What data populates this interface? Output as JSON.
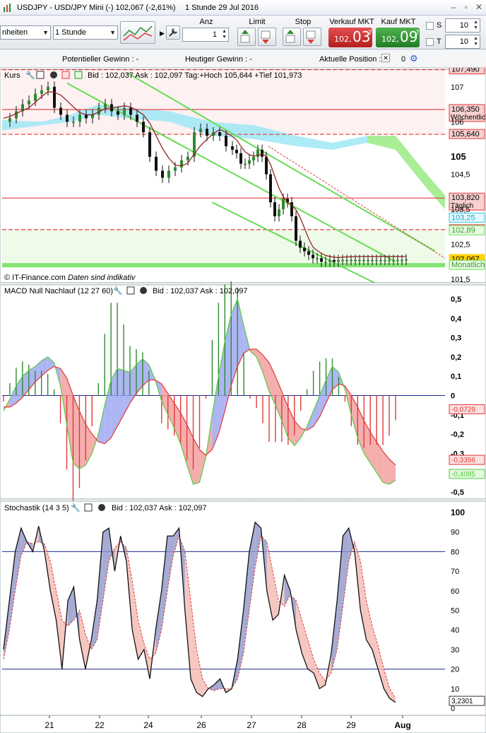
{
  "window": {
    "title": "USDJPY - USD/JPY Mini (-)",
    "quote": "102,067 (-2,61%)",
    "timeframe_date": "1 Stunde  29 Jul 2016"
  },
  "toolbar": {
    "units_select": "nheiten",
    "interval_select": "1 Stunde",
    "qty_label": "Anz",
    "qty_value": "1",
    "limit_label": "Limit",
    "stop_label": "Stop",
    "sell_label": "Verkauf MKT",
    "sell_small": "102,",
    "sell_big": "03",
    "sell_sup": "7",
    "buy_label": "Kauf MKT",
    "buy_small": "102,",
    "buy_big": "09",
    "buy_sup": "7",
    "s_label": "S",
    "s_value": "10",
    "t_label": "T",
    "t_value": "10"
  },
  "status": {
    "potential_profit": "Potentieller Gewinn : -",
    "today_profit": "Heutiger Gewinn : -",
    "position": "Aktuelle Position : 0",
    "position_extra": "0"
  },
  "colors": {
    "bull": "#2e8b2e",
    "bear": "#e03a3a",
    "green_line": "#66dd55",
    "cloud_cyan": "#9fe8f5",
    "cloud_green": "#a8ee8c",
    "macd_blue": "#9aa2f0",
    "macd_red": "#f29a9a",
    "stoch_blue": "#1f2a8f"
  },
  "chart_data": [
    {
      "type": "line",
      "title": "Kurs",
      "header": "Bid : 102,037 Ask : 102,097 Tag:+Hoch 105,644 +Tief 101,973",
      "source": "© IT-Finance.com",
      "disclaimer": "Daten sind indikativ",
      "y_ticks": [
        "107",
        "106",
        "105",
        "104,5",
        "103,5",
        "102,5",
        "101,5"
      ],
      "ylim": [
        101.4,
        107.5
      ],
      "x_dates": [
        "21",
        "22",
        "24",
        "26",
        "27",
        "28",
        "29",
        "Aug"
      ],
      "close_series": {
        "name": "USDJPY",
        "x": [
          0,
          3,
          6,
          9,
          12,
          15,
          18,
          21,
          24,
          27,
          30,
          33,
          36,
          39,
          42,
          45,
          48,
          51,
          54,
          57,
          60,
          63,
          66,
          69,
          72,
          75,
          78,
          81,
          84,
          87,
          90,
          93,
          96,
          99,
          102,
          105,
          108,
          110,
          112,
          114,
          116,
          118,
          120,
          122,
          124,
          126,
          128,
          130,
          132,
          134,
          136,
          138,
          140,
          142,
          144,
          146,
          148,
          150,
          152,
          154,
          156,
          158,
          160,
          162,
          164,
          166,
          168,
          170,
          172,
          174,
          176,
          178,
          180,
          182,
          184,
          186,
          188,
          190
        ],
        "values": [
          106.0,
          106.1,
          106.3,
          106.5,
          106.6,
          106.8,
          106.9,
          107.0,
          106.4,
          106.2,
          106.0,
          106.0,
          106.2,
          106.1,
          106.2,
          106.4,
          106.5,
          106.3,
          106.2,
          106.4,
          106.2,
          106.0,
          105.7,
          105.0,
          104.6,
          104.4,
          104.6,
          104.7,
          104.9,
          105.0,
          105.7,
          105.8,
          105.6,
          105.7,
          105.6,
          105.3,
          105.2,
          105.1,
          104.8,
          104.8,
          104.9,
          105.0,
          105.2,
          105.0,
          104.5,
          103.7,
          103.3,
          103.5,
          103.8,
          103.7,
          103.3,
          102.6,
          102.4,
          102.3,
          102.2,
          102.1,
          102.1,
          102.0,
          102.0,
          102.05,
          102.0,
          102.05,
          102.05,
          102.05,
          102.05,
          102.05,
          102.05,
          102.05,
          102.05,
          102.05,
          102.05,
          102.05,
          102.05,
          102.05,
          102.05,
          102.05,
          102.05,
          102.067
        ]
      },
      "levels": [
        {
          "label": "107,490",
          "value": 107.49,
          "color": "#e03a3a"
        },
        {
          "label": "106,350",
          "sublabel": "Wöchentlich",
          "value": 106.35,
          "color": "#e03a3a"
        },
        {
          "label": "105,640",
          "value": 105.64,
          "color": "#e03a3a"
        },
        {
          "label": "103,820",
          "sublabel": "Täglich",
          "value": 103.82,
          "color": "#e03a3a"
        },
        {
          "label": "103,25",
          "value": 103.25,
          "color": "#33c8e8"
        },
        {
          "label": "102,918",
          "value": 102.918,
          "color": "#e03a3a"
        },
        {
          "label": "102,89",
          "value": 102.89,
          "color": "#66dd55"
        },
        {
          "label": "102,067",
          "value": 102.067,
          "color": "#ffd400"
        },
        {
          "label": "Monatlich",
          "value": 101.9,
          "color": "#66dd55"
        }
      ]
    },
    {
      "type": "bar",
      "title": "MACD Null Nachlauf (12 27 60)",
      "header": "Bid : 102,037 Ask : 102,097",
      "y_ticks": [
        "0,5",
        "0,4",
        "0,3",
        "0,2",
        "0,1",
        "0",
        "-0,1",
        "-0,2",
        "-0,3",
        "-0,4",
        "-0,5"
      ],
      "ylim": [
        -0.5,
        0.5
      ],
      "last_values": [
        {
          "label": "-0,0729",
          "value": -0.0729,
          "color": "#e03a3a"
        },
        {
          "label": "-0,3356",
          "value": -0.3356,
          "color": "#e03a3a"
        },
        {
          "label": "-0,4085",
          "value": -0.4085,
          "color": "#55cc44"
        }
      ],
      "macd": [
        -0.08,
        -0.02,
        0.05,
        0.1,
        0.13,
        0.15,
        0.18,
        0.2,
        0.17,
        0.05,
        -0.15,
        -0.35,
        -0.38,
        -0.36,
        -0.3,
        -0.2,
        -0.05,
        0.08,
        0.14,
        0.13,
        0.12,
        0.16,
        0.19,
        0.16,
        0.08,
        -0.03,
        -0.1,
        -0.17,
        -0.25,
        -0.36,
        -0.46,
        -0.45,
        -0.32,
        -0.1,
        0.1,
        0.28,
        0.42,
        0.5,
        0.36,
        0.23,
        0.2,
        0.12,
        0.02,
        -0.05,
        -0.13,
        -0.22,
        -0.26,
        -0.22,
        -0.16,
        -0.08,
        0.0,
        0.08,
        0.15,
        0.12,
        0.03,
        -0.1,
        -0.22,
        -0.3,
        -0.35,
        -0.4,
        -0.45,
        -0.46,
        -0.44
      ],
      "signal": [
        -0.06,
        -0.06,
        -0.04,
        -0.01,
        0.03,
        0.07,
        0.1,
        0.13,
        0.15,
        0.14,
        0.09,
        0.0,
        -0.08,
        -0.15,
        -0.2,
        -0.24,
        -0.25,
        -0.22,
        -0.16,
        -0.1,
        -0.04,
        0.01,
        0.05,
        0.08,
        0.08,
        0.06,
        0.01,
        -0.04,
        -0.09,
        -0.15,
        -0.22,
        -0.28,
        -0.31,
        -0.28,
        -0.2,
        -0.08,
        0.05,
        0.15,
        0.22,
        0.24,
        0.24,
        0.21,
        0.17,
        0.1,
        0.02,
        -0.06,
        -0.13,
        -0.17,
        -0.18,
        -0.16,
        -0.11,
        -0.04,
        0.03,
        0.06,
        0.05,
        0.0,
        -0.06,
        -0.13,
        -0.19,
        -0.24,
        -0.29,
        -0.33,
        -0.36
      ]
    },
    {
      "type": "line",
      "title": "Stochastik (14 3 5)",
      "header": "Bid : 102,037 Ask : 102,097",
      "y_ticks": [
        "100",
        "90",
        "80",
        "70",
        "60",
        "50",
        "40",
        "30",
        "20",
        "10",
        "0"
      ],
      "ylim": [
        0,
        100
      ],
      "levels": [
        80,
        20
      ],
      "last_value": "3,2301",
      "k": [
        30,
        55,
        80,
        92,
        85,
        80,
        93,
        80,
        60,
        45,
        20,
        55,
        62,
        35,
        20,
        35,
        55,
        90,
        92,
        70,
        88,
        75,
        40,
        25,
        30,
        15,
        40,
        60,
        88,
        88,
        92,
        50,
        15,
        8,
        6,
        10,
        12,
        15,
        8,
        10,
        25,
        50,
        80,
        95,
        92,
        60,
        45,
        48,
        68,
        60,
        40,
        28,
        20,
        18,
        10,
        12,
        28,
        55,
        88,
        92,
        80,
        50,
        35,
        30,
        20,
        10,
        5,
        3
      ],
      "d": [
        25,
        40,
        60,
        78,
        85,
        84,
        85,
        84,
        75,
        60,
        45,
        42,
        45,
        50,
        38,
        30,
        35,
        55,
        75,
        82,
        85,
        82,
        65,
        45,
        33,
        25,
        28,
        40,
        60,
        78,
        88,
        80,
        55,
        30,
        15,
        10,
        9,
        10,
        10,
        10,
        15,
        28,
        50,
        72,
        88,
        85,
        70,
        55,
        52,
        58,
        55,
        45,
        35,
        25,
        18,
        14,
        18,
        30,
        52,
        75,
        85,
        75,
        55,
        42,
        32,
        20,
        10,
        5
      ]
    }
  ]
}
